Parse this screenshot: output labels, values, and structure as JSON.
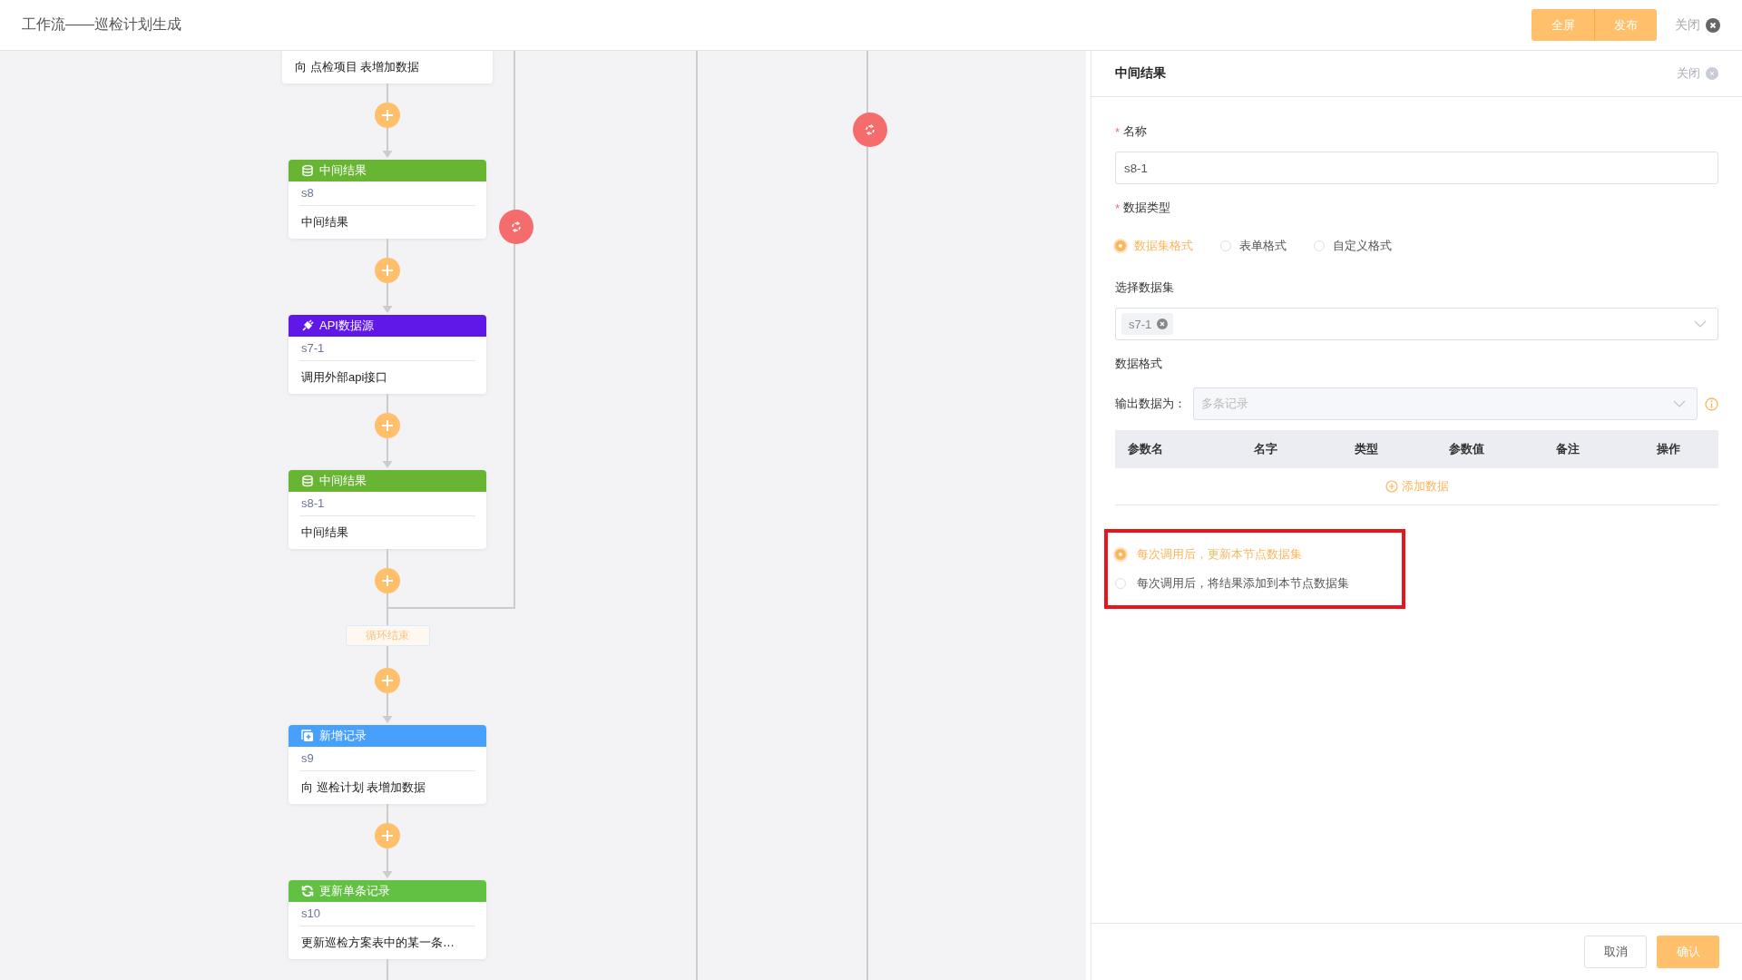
{
  "header": {
    "title": "工作流——巡检计划生成",
    "buttons": [
      "全屏",
      "发布"
    ],
    "close": "关闭"
  },
  "flow": {
    "items": [
      {
        "kind": "partial",
        "description": "向 点检项目 表增加数据"
      },
      {
        "kind": "connector",
        "arrow": true
      },
      {
        "kind": "dataset",
        "title": "中间结果",
        "id": "s8",
        "description": "中间结果"
      },
      {
        "kind": "connector",
        "arrow": true
      },
      {
        "kind": "api",
        "title": "API数据源",
        "id": "s7-1",
        "description": "调用外部api接口"
      },
      {
        "kind": "connector",
        "arrow": true
      },
      {
        "kind": "dataset",
        "title": "中间结果",
        "id": "s8-1",
        "description": "中间结果"
      },
      {
        "kind": "connector",
        "arrow": false
      },
      {
        "kind": "tag",
        "label": "循环结束"
      },
      {
        "kind": "connector",
        "arrow": true
      },
      {
        "kind": "add",
        "title": "新增记录",
        "id": "s9",
        "description": "向 巡检计划 表增加数据"
      },
      {
        "kind": "connector",
        "arrow": true
      },
      {
        "kind": "update",
        "title": "更新单条记录",
        "id": "s10",
        "description": "更新巡检方案表中的某一条…"
      }
    ]
  },
  "panel": {
    "title": "中间结果",
    "close": "关闭",
    "name_field": {
      "mark": "*",
      "label": "名称",
      "value": "s8-1"
    },
    "data_type": {
      "mark": "*",
      "label": "数据类型",
      "options": [
        {
          "label": "数据集格式",
          "selected": true
        },
        {
          "label": "表单格式",
          "selected": false
        },
        {
          "label": "自定义格式",
          "selected": false
        }
      ]
    },
    "dataset": {
      "label": "选择数据集",
      "tags": [
        "s7-1"
      ]
    },
    "data_format": {
      "label": "数据格式",
      "output_label": "输出数据为：",
      "output_placeholder": "多条记录",
      "disabled": true
    },
    "table": {
      "columns": [
        "参数名",
        "名字",
        "类型",
        "参数值",
        "备注",
        "操作"
      ],
      "add_link": "添加数据"
    },
    "update_mode": {
      "options": [
        {
          "label": "每次调用后，更新本节点数据集",
          "selected": true
        },
        {
          "label": "每次调用后，将结果添加到本节点数据集",
          "selected": false
        }
      ]
    },
    "footer": {
      "buttons": [
        {
          "label": "取消",
          "kind": "secondary"
        },
        {
          "label": "确认",
          "kind": "primary"
        }
      ]
    }
  }
}
